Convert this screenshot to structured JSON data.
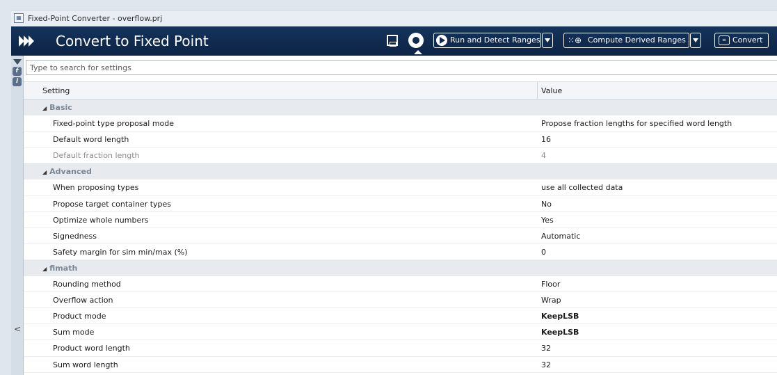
{
  "window": {
    "title": "Fixed-Point Converter - overflow.prj"
  },
  "toolstrip": {
    "heading": "Convert to Fixed Point",
    "run_button_label": "Run and Detect Ranges",
    "derive_button_label": "Compute Derived Ranges",
    "convert_button_label": "Convert"
  },
  "search": {
    "placeholder": "Type to search for settings"
  },
  "table": {
    "col_setting": "Setting",
    "col_value": "Value"
  },
  "groups": [
    {
      "name": "Basic",
      "rows": [
        {
          "setting": "Fixed-point type proposal mode",
          "value": "Propose fraction lengths for specified word length"
        },
        {
          "setting": "Default word length",
          "value": "16"
        },
        {
          "setting": "Default fraction length",
          "value": "4"
        }
      ]
    },
    {
      "name": "Advanced",
      "rows": [
        {
          "setting": "When proposing types",
          "value": "use all collected data"
        },
        {
          "setting": "Propose target container types",
          "value": "No"
        },
        {
          "setting": "Optimize whole numbers",
          "value": "Yes"
        },
        {
          "setting": "Signedness",
          "value": "Automatic"
        },
        {
          "setting": "Safety margin for sim min/max (%)",
          "value": "0"
        }
      ]
    },
    {
      "name": "fimath",
      "rows": [
        {
          "setting": "Rounding method",
          "value": "Floor"
        },
        {
          "setting": "Overflow action",
          "value": "Wrap"
        },
        {
          "setting": "Product mode",
          "value": "KeepLSB"
        },
        {
          "setting": "Sum mode",
          "value": "KeepLSB"
        },
        {
          "setting": "Product word length",
          "value": "32"
        },
        {
          "setting": "Sum word length",
          "value": "32"
        }
      ]
    }
  ],
  "rail": {
    "collapse_glyph": "<"
  }
}
